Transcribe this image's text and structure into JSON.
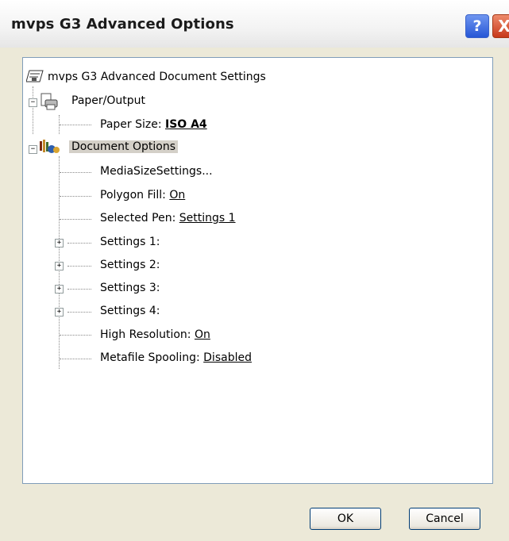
{
  "window": {
    "title": "mvps G3 Advanced Options",
    "help_button": "?",
    "close_button": "X"
  },
  "tree": {
    "root": "mvps G3 Advanced Document Settings",
    "paper_output": "Paper/Output",
    "paper_size_label": "Paper Size: ",
    "paper_size_value": "ISO A4",
    "document_options": "Document Options",
    "media_size_settings": "MediaSizeSettings...",
    "polygon_fill_label": "Polygon Fill: ",
    "polygon_fill_value": "On",
    "selected_pen_label": "Selected Pen: ",
    "selected_pen_value": "Settings 1",
    "settings_1": "Settings 1:",
    "settings_2": "Settings 2:",
    "settings_3": "Settings 3:",
    "settings_4": "Settings 4:",
    "high_resolution_label": "High Resolution: ",
    "high_resolution_value": "On",
    "metafile_spooling_label": "Metafile Spooling: ",
    "metafile_spooling_value": "Disabled"
  },
  "buttons": {
    "ok": "OK",
    "cancel": "Cancel"
  },
  "icons": [
    "printer-settings-icon",
    "paper-output-icon",
    "document-options-icon",
    "minus-expander-icon",
    "plus-expander-icon"
  ]
}
